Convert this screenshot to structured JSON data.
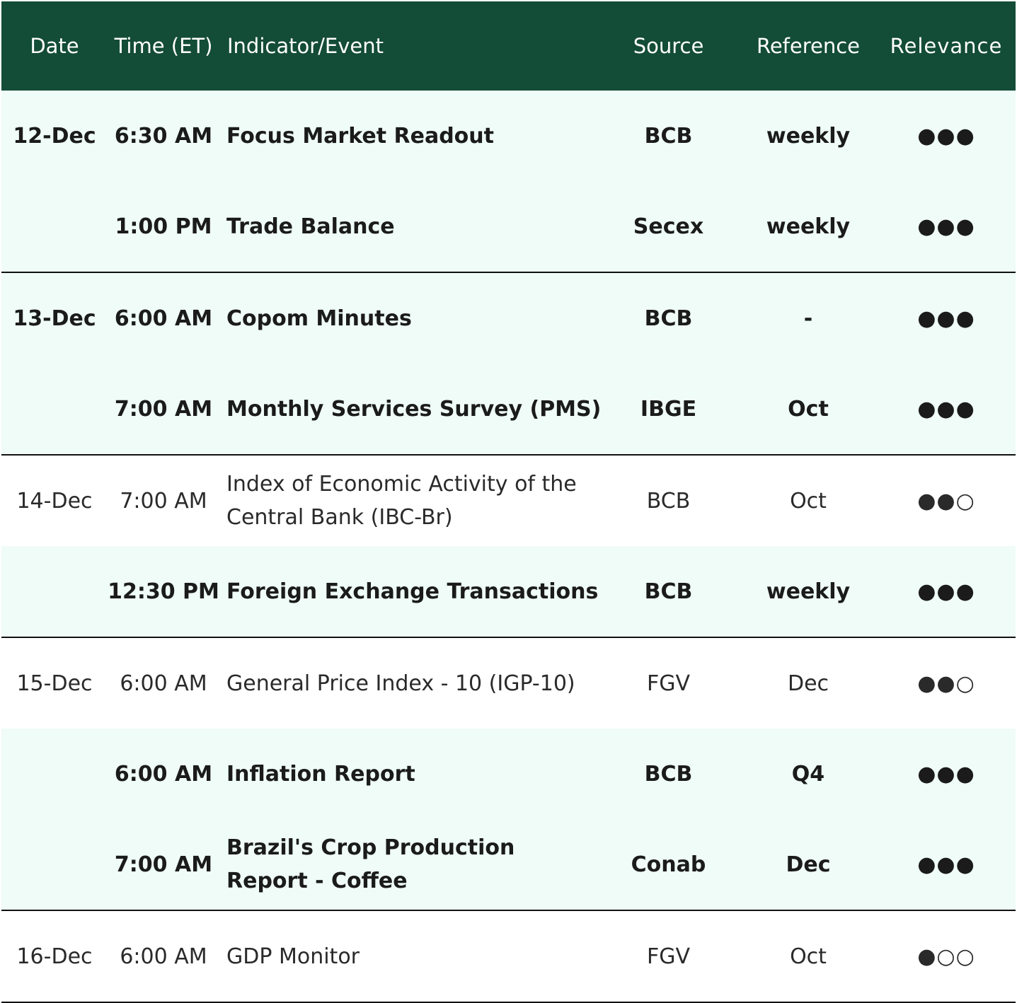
{
  "header": {
    "date": "Date",
    "time": "Time (ET)",
    "indicator": "Indicator/Event",
    "source": "Source",
    "reference": "Reference",
    "relevance": "Relevance"
  },
  "colors": {
    "header_bg": "#134c37",
    "highlight_row_bg": "#effcf7",
    "separator": "#111111"
  },
  "rows": [
    {
      "date": "12-Dec",
      "time": "6:30 AM",
      "indicator": "Focus Market Readout",
      "source": "BCB",
      "reference": "weekly",
      "relevance": "●●●",
      "bold": true
    },
    {
      "date": "",
      "time": "1:00 PM",
      "indicator": "Trade Balance",
      "source": "Secex",
      "reference": "weekly",
      "relevance": "●●●",
      "bold": true
    },
    {
      "date": "13-Dec",
      "time": "6:00 AM",
      "indicator": "Copom Minutes",
      "source": "BCB",
      "reference": "-",
      "relevance": "●●●",
      "bold": true
    },
    {
      "date": "",
      "time": "7:00 AM",
      "indicator": "Monthly Services Survey (PMS)",
      "source": "IBGE",
      "reference": "Oct",
      "relevance": "●●●",
      "bold": true
    },
    {
      "date": "14-Dec",
      "time": "7:00 AM",
      "indicator": "Index of Economic Activity of the Central Bank (IBC-Br)",
      "source": "BCB",
      "reference": "Oct",
      "relevance": "●●○",
      "bold": false
    },
    {
      "date": "",
      "time": "12:30 PM",
      "indicator": "Foreign Exchange Transactions",
      "source": "BCB",
      "reference": "weekly",
      "relevance": "●●●",
      "bold": true
    },
    {
      "date": "15-Dec",
      "time": "6:00 AM",
      "indicator": "General Price Index - 10 (IGP-10)",
      "source": "FGV",
      "reference": "Dec",
      "relevance": "●●○",
      "bold": false
    },
    {
      "date": "",
      "time": "6:00 AM",
      "indicator": "Inflation Report",
      "source": "BCB",
      "reference": "Q4",
      "relevance": "●●●",
      "bold": true
    },
    {
      "date": "",
      "time": "7:00 AM",
      "indicator": "Brazil's Crop Production Report - Coffee",
      "source": "Conab",
      "reference": "Dec",
      "relevance": "●●●",
      "bold": true
    },
    {
      "date": "16-Dec",
      "time": "6:00 AM",
      "indicator": "GDP Monitor",
      "source": "FGV",
      "reference": "Oct",
      "relevance": "●○○",
      "bold": false
    }
  ]
}
